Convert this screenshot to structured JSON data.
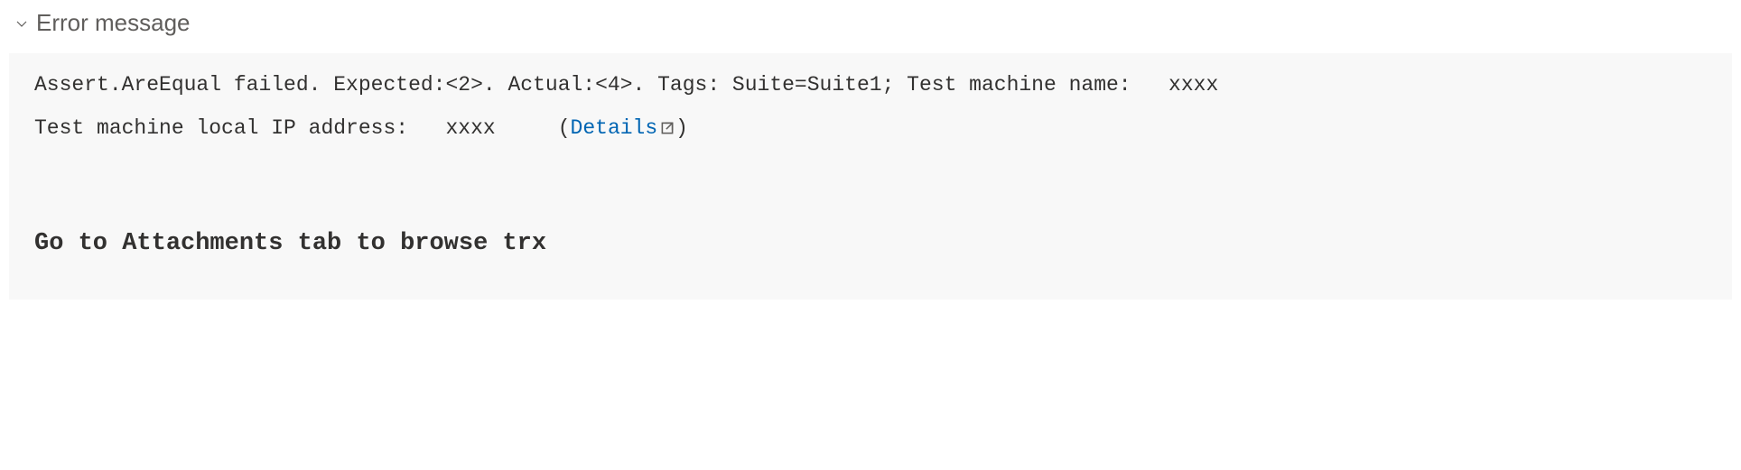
{
  "header": {
    "title": "Error message"
  },
  "error": {
    "line1_prefix": "Assert.AreEqual failed. Expected:<2>. Actual:<4>. Tags: Suite=Suite1; Test machine name:",
    "line1_value": "xxxx",
    "line2_prefix": "Test machine local IP address:",
    "line2_value": "xxxx",
    "details_label": "Details"
  },
  "hint": {
    "text": "Go to Attachments tab to browse trx"
  }
}
